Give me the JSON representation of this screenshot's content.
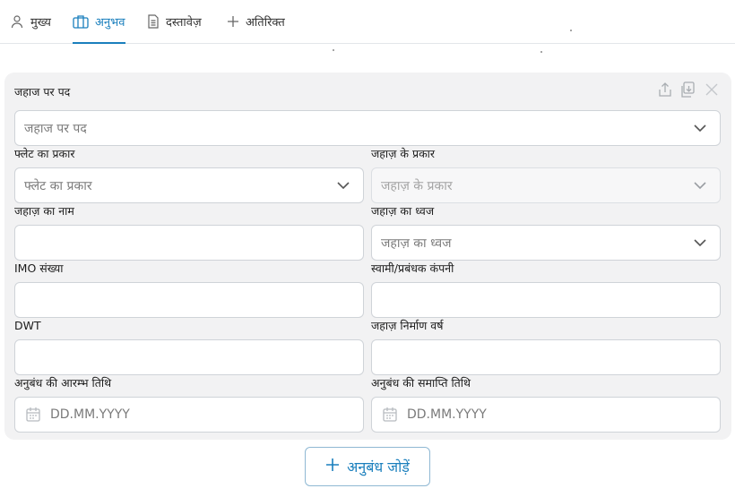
{
  "tabs": [
    {
      "label": "मुख्य",
      "icon": "person-icon"
    },
    {
      "label": "अनुभव",
      "icon": "briefcase-icon",
      "active": true
    },
    {
      "label": "दस्तावेज़",
      "icon": "document-icon"
    },
    {
      "label": "अतिरिक्त",
      "icon": "plus-icon"
    }
  ],
  "card": {
    "actions": [
      "upload-icon",
      "copy-icon",
      "close-icon"
    ],
    "position": {
      "label": "जहाज पर पद",
      "placeholder": "जहाज पर पद"
    },
    "fleet_type": {
      "label": "फ्लेट का प्रकार",
      "placeholder": "फ्लेट का प्रकार"
    },
    "vessel_type": {
      "label": "जहाज़ के प्रकार",
      "placeholder": "जहाज़ के प्रकार"
    },
    "vessel_name": {
      "label": "जहाज़ का नाम",
      "value": ""
    },
    "vessel_flag": {
      "label": "जहाज़ का ध्वज",
      "placeholder": "जहाज़ का ध्वज"
    },
    "imo_number": {
      "label": "IMO संख्या",
      "value": ""
    },
    "owner_company": {
      "label": "स्वामी/प्रबंधक कंपनी",
      "value": ""
    },
    "dwt": {
      "label": "DWT",
      "value": ""
    },
    "build_year": {
      "label": "जहाज़ निर्माण वर्ष",
      "value": ""
    },
    "contract_start": {
      "label": "अनुबंध की आरम्भ तिथि",
      "placeholder": "DD.MM.YYYY"
    },
    "contract_end": {
      "label": "अनुबंध की समाप्ति तिथि",
      "placeholder": "DD.MM.YYYY"
    }
  },
  "add_button": {
    "label": "अनुबंध जोड़ें",
    "icon": "plus-icon"
  },
  "colors": {
    "accent": "#1a7fbd",
    "card_bg": "#f2f2f3",
    "border": "#cfd3d8"
  }
}
